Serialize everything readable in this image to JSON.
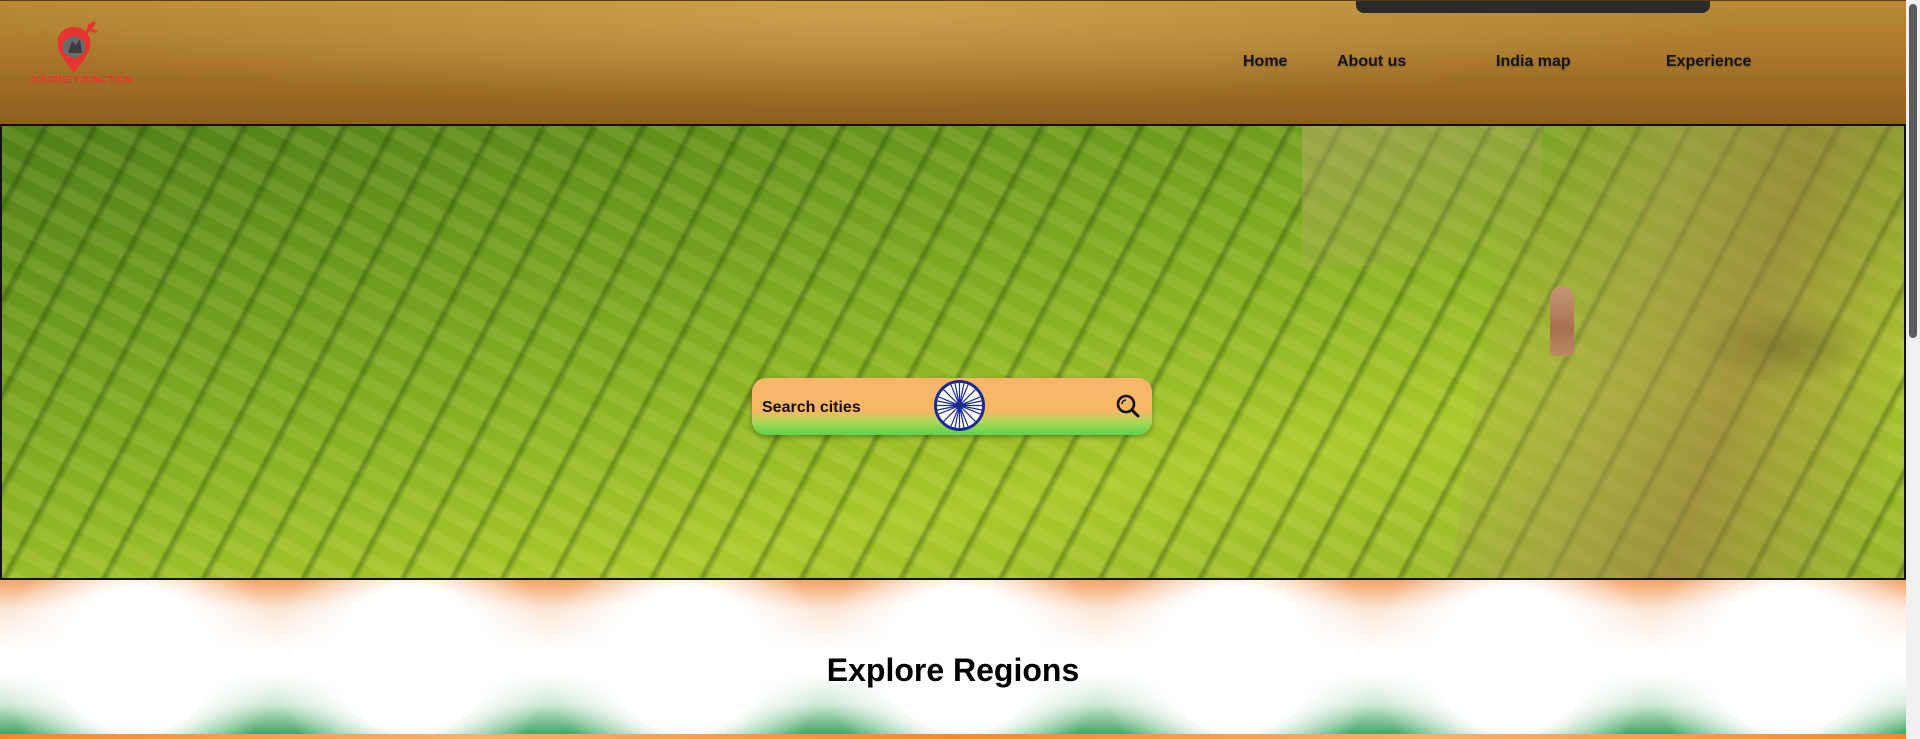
{
  "brand": {
    "name": "JOURNEYJUNCTION",
    "logo_icon": "map-pin-plane-icon",
    "brand_color": "#e8332f"
  },
  "nav": {
    "items": [
      {
        "label": "Home"
      },
      {
        "label": "About us"
      },
      {
        "label": "India map"
      },
      {
        "label": "Experience"
      }
    ]
  },
  "search": {
    "placeholder": "Search cities",
    "value": "",
    "emblem_icon": "ashoka-chakra-icon",
    "button_icon": "search-icon"
  },
  "explore": {
    "title": "Explore Regions"
  },
  "colors": {
    "header": "#a9782b",
    "saffron": "#f7b766",
    "green": "#5ad34c",
    "chakra_blue": "#1a2a9a"
  }
}
